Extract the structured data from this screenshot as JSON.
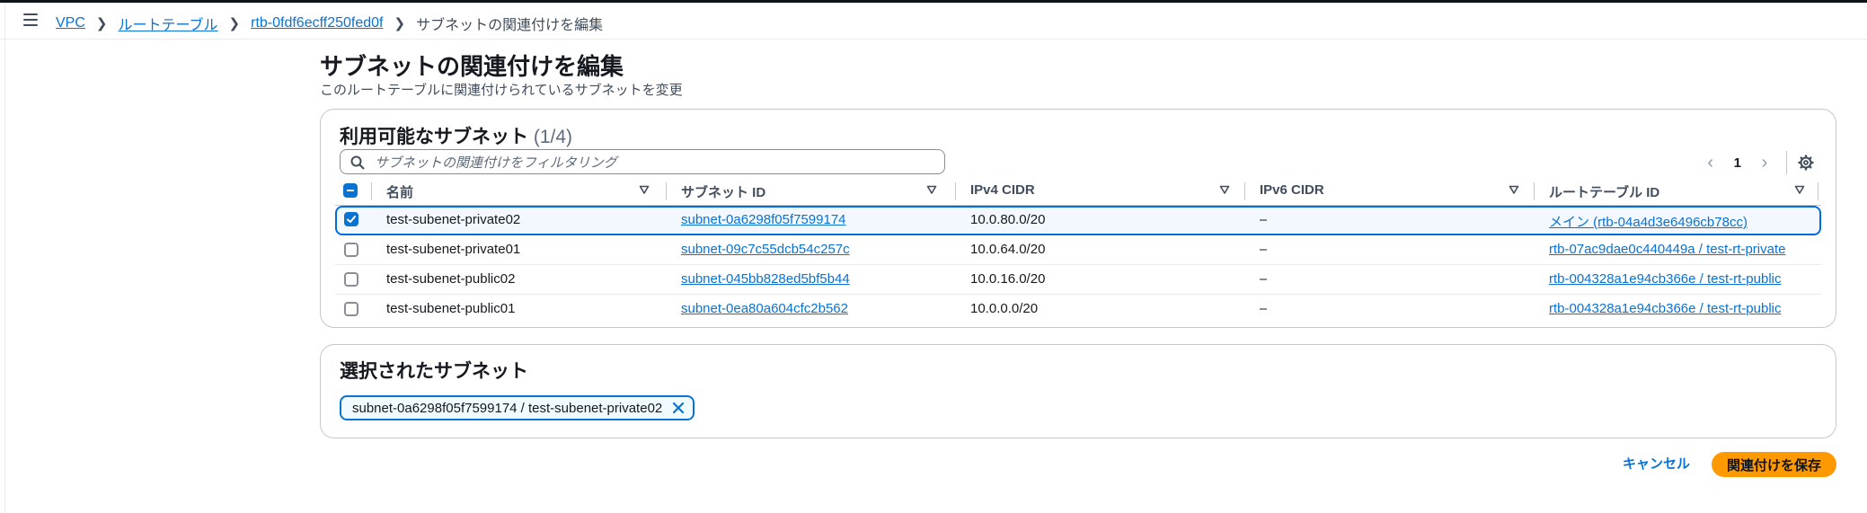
{
  "breadcrumb": {
    "items": [
      "VPC",
      "ルートテーブル",
      "rtb-0fdf6ecff250fed0f"
    ],
    "current": "サブネットの関連付けを編集"
  },
  "page": {
    "title": "サブネットの関連付けを編集",
    "description": "このルートテーブルに関連付けられているサブネットを変更"
  },
  "available": {
    "title": "利用可能なサブネット",
    "count": "(1/4)",
    "search_placeholder": "サブネットの関連付けをフィルタリング",
    "pagination": {
      "current_page": "1"
    },
    "columns": [
      "名前",
      "サブネット ID",
      "IPv4 CIDR",
      "IPv6 CIDR",
      "ルートテーブル ID"
    ],
    "rows": [
      {
        "checked": true,
        "name": "test-subenet-private02",
        "subnet_id": "subnet-0a6298f05f7599174",
        "ipv4": "10.0.80.0/20",
        "ipv6": "–",
        "route_table": "メイン (rtb-04a4d3e6496cb78cc)"
      },
      {
        "checked": false,
        "name": "test-subenet-private01",
        "subnet_id": "subnet-09c7c55dcb54c257c",
        "ipv4": "10.0.64.0/20",
        "ipv6": "–",
        "route_table": "rtb-07ac9dae0c440449a / test-rt-private"
      },
      {
        "checked": false,
        "name": "test-subenet-public02",
        "subnet_id": "subnet-045bb828ed5bf5b44",
        "ipv4": "10.0.16.0/20",
        "ipv6": "–",
        "route_table": "rtb-004328a1e94cb366e / test-rt-public"
      },
      {
        "checked": false,
        "name": "test-subenet-public01",
        "subnet_id": "subnet-0ea80a604cfc2b562",
        "ipv4": "10.0.0.0/20",
        "ipv6": "–",
        "route_table": "rtb-004328a1e94cb366e / test-rt-public"
      }
    ]
  },
  "selected": {
    "title": "選択されたサブネット",
    "tokens": [
      "subnet-0a6298f05f7599174 / test-subenet-private02"
    ]
  },
  "actions": {
    "cancel": "キャンセル",
    "save": "関連付けを保存"
  },
  "colors": {
    "accent": "#0972d3",
    "primary_button": "#ff9900",
    "selected_row_bg": "#f2f8fd"
  }
}
